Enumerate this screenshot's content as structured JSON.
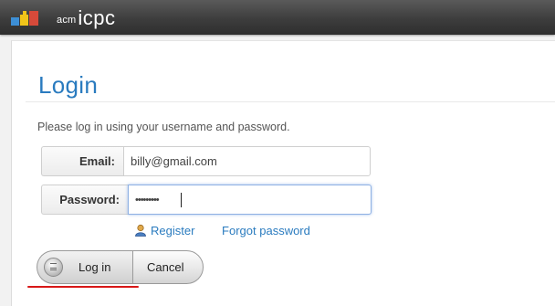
{
  "brand": {
    "small_text": "acm",
    "big_text": "icpc"
  },
  "page": {
    "title": "Login",
    "instructions": "Please log in using your username and password."
  },
  "form": {
    "email": {
      "label": "Email:",
      "value": "billy@gmail.com"
    },
    "password": {
      "label": "Password:",
      "value": "•••••••••"
    }
  },
  "links": {
    "register": "Register",
    "forgot_password": "Forgot password"
  },
  "buttons": {
    "login": "Log in",
    "cancel": "Cancel"
  },
  "colors": {
    "accent": "#2a7bbf",
    "annotation": "#d81818"
  }
}
